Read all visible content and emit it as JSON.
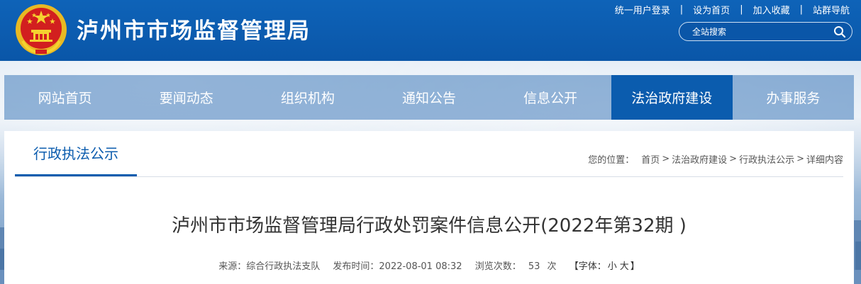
{
  "header": {
    "site_title": "泸州市市场监督管理局",
    "top_links": [
      "统一用户登录",
      "设为首页",
      "加入收藏",
      "站群导航"
    ],
    "search_placeholder": "全站搜索",
    "brand_color": "#0b5cae"
  },
  "nav": {
    "items": [
      {
        "label": "网站首页",
        "active": false
      },
      {
        "label": "要闻动态",
        "active": false
      },
      {
        "label": "组织机构",
        "active": false
      },
      {
        "label": "通知公告",
        "active": false
      },
      {
        "label": "信息公开",
        "active": false
      },
      {
        "label": "法治政府建设",
        "active": true
      },
      {
        "label": "办事服务",
        "active": false
      }
    ]
  },
  "section": {
    "title": "行政执法公示"
  },
  "breadcrumb": {
    "prefix": "您的位置：",
    "items": [
      "首页",
      "法治政府建设",
      "行政执法公示",
      "详细内容"
    ]
  },
  "article": {
    "title": "泸州市市场监督管理局行政处罚案件信息公开(2022年第32期 )",
    "source_label": "来源：",
    "source": "综合行政执法支队",
    "time_label": "发布时间：",
    "time": "2022-08-01 08:32",
    "views_label": "浏览次数：",
    "views": "53",
    "views_unit": "次",
    "font_open": "【字体：",
    "font_small": "小",
    "font_large": "大",
    "font_close": "】"
  },
  "icons": {
    "emblem": "national-emblem-icon",
    "search": "search-icon"
  }
}
